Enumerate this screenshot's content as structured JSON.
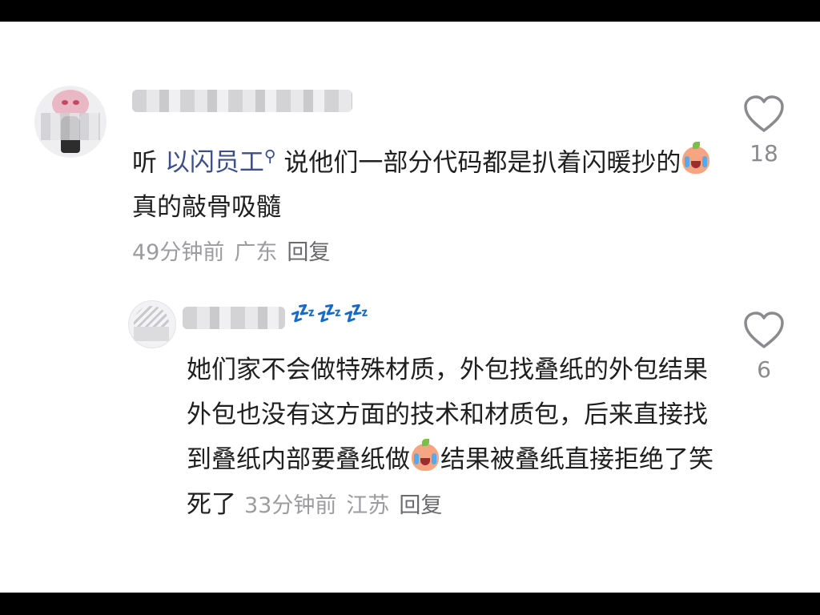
{
  "comments": [
    {
      "text_before": "听 ",
      "mention": "以闪员工",
      "text_after_1": " 说他们一部分代码都是扒着闪暖抄的",
      "text_after_2": "真的敲骨吸髓",
      "emoji": "crying-laughing-peach-emoji",
      "time": "49分钟前",
      "location": "广东",
      "reply_label": "回复",
      "likes": "18"
    },
    {
      "name_suffix": "💤💤💤",
      "text_1": "她们家不会做特殊材质，外包找叠纸的外包结果外包也没有这方面的技术和材质包，后来直接找到叠纸内部要叠纸做",
      "emoji": "crying-laughing-peach-emoji",
      "text_2": "结果被叠纸直接拒绝了笑死了",
      "time": "33分钟前",
      "location": "江苏",
      "reply_label": "回复",
      "likes": "6"
    }
  ],
  "colors": {
    "mention": "#3d4e8c",
    "text": "#1f1f1f",
    "meta": "#9c9ca0",
    "zzz": "#4557d9"
  }
}
